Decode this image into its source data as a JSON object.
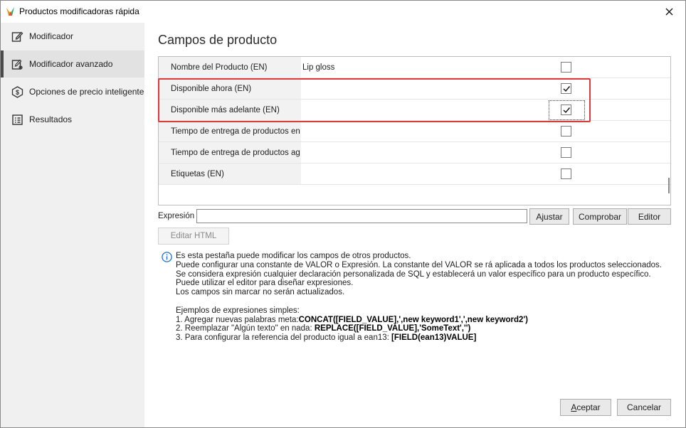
{
  "window": {
    "title": "Productos modificadoras rápida",
    "close_icon": "close-icon"
  },
  "sidebar": {
    "items": [
      {
        "label": "Modificador",
        "icon": "edit-icon"
      },
      {
        "label": "Modificador avanzado",
        "icon": "advanced-edit-icon",
        "active": true
      },
      {
        "label": "Opciones de precio inteligente",
        "icon": "price-icon"
      },
      {
        "label": "Resultados",
        "icon": "results-icon"
      }
    ]
  },
  "main": {
    "title": "Campos de producto",
    "fields": [
      {
        "label": "Nombre del Producto (EN)",
        "value": "Lip gloss",
        "checked": false
      },
      {
        "label": "Disponible ahora (EN)",
        "value": "",
        "checked": true
      },
      {
        "label": "Disponible más adelante (EN)",
        "value": "",
        "checked": true
      },
      {
        "label": "Tiempo de entrega de productos en",
        "value": "",
        "checked": false
      },
      {
        "label": "Tiempo de entrega de productos ag",
        "value": "",
        "checked": false
      },
      {
        "label": "Etiquetas (EN)",
        "value": "",
        "checked": false
      }
    ],
    "expression": {
      "label": "Expresión",
      "value": "",
      "buttons": [
        "Ajustar",
        "Comprobar",
        "Editor"
      ]
    },
    "edit_html_label": "Editar HTML",
    "info": {
      "lines": [
        "Es esta pestaña puede modificar los campos de otros productos.",
        "Puede configurar una constante de VALOR o Expresión. La constante del VALOR se rá aplicada a todos los productos seleccionados. Se considera expresión cualquier declaración personalizada de SQL y establecerá un valor específico para un producto específico. Puede utilizar el editor para diseñar expresiones.",
        "Los campos sin marcar no serán actualizados."
      ],
      "examples_title": "Ejemplos de expresiones simples:",
      "examples": [
        {
          "prefix": "1. Agregar nuevas palabras meta:",
          "code": "CONCAT([FIELD_VALUE],',new keyword1',',new keyword2')"
        },
        {
          "prefix": "2. Reemplazar \"Algún texto\" en nada: ",
          "code": "REPLACE([FIELD_VALUE],'SomeText','')"
        },
        {
          "prefix": "3. Para configurar la referencia del producto igual a ean13: ",
          "code": "[FIELD(ean13)VALUE]"
        }
      ]
    }
  },
  "footer": {
    "accept_label_first": "A",
    "accept_label_rest": "ceptar",
    "cancel_label": "Cancelar"
  },
  "colors": {
    "highlight": "#e0383c",
    "sidebar_bg": "#f0f0f0",
    "info": "#1f6fd1"
  }
}
